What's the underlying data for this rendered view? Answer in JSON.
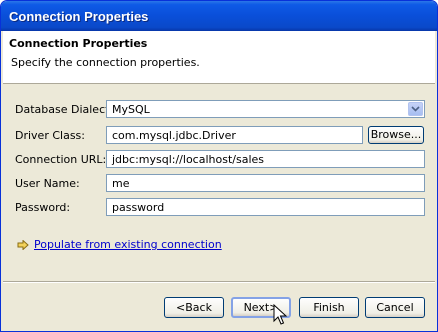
{
  "window": {
    "title": "Connection Properties"
  },
  "header": {
    "title": "Connection Properties",
    "description": "Specify the connection properties."
  },
  "form": {
    "dialect_label": "Database Dialect:",
    "dialect_value": "MySQL",
    "driver_label": "Driver Class:",
    "driver_value": "com.mysql.jdbc.Driver",
    "browse_label": "Browse...",
    "url_label": "Connection URL:",
    "url_value": "jdbc:mysql://localhost/sales",
    "user_label": "User Name:",
    "user_value": "me",
    "password_label": "Password:",
    "password_value": "password"
  },
  "populate_link": "Populate from existing connection",
  "buttons": {
    "back": "<Back",
    "next": "Next>",
    "finish": "Finish",
    "cancel": "Cancel"
  },
  "icons": [
    "chevron-down-icon",
    "arrow-right-icon",
    "mouse-pointer-icon"
  ],
  "colors": {
    "titlebar": "#0a4fd9",
    "link": "#0000cc",
    "dialog_bg": "#ece9d8"
  }
}
